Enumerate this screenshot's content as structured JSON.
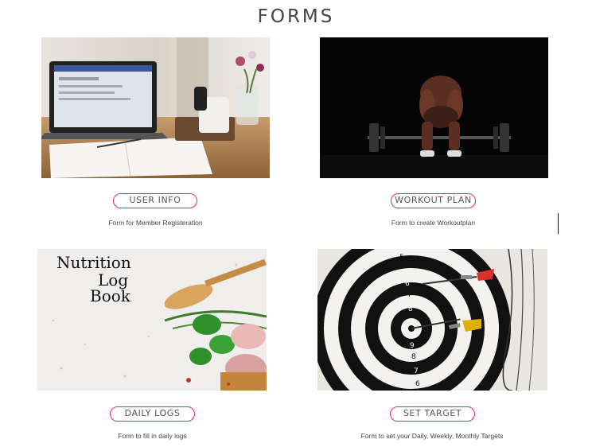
{
  "page": {
    "title": "FORMS"
  },
  "cards": [
    {
      "button_label": "USER INFO",
      "description": "Form for Member Registeration"
    },
    {
      "button_label": "WORKOUT PLAN",
      "description": "Form to create Workoutplan"
    },
    {
      "button_label": "DAILY LOGS",
      "description": "Form to fill in daily logs"
    },
    {
      "button_label": "SET TARGET",
      "description": "Form to set your Daily, Weekly, Monthly Targets"
    }
  ],
  "images": {
    "nutrition_book_text": [
      "Nutrition",
      "Log",
      "Book"
    ],
    "dartboard_numbers": [
      "5",
      "6",
      "7",
      "8",
      "9",
      "8",
      "7",
      "6"
    ]
  },
  "colors": {
    "accent": "#e0286f",
    "title": "#444444",
    "text": "#444444"
  }
}
